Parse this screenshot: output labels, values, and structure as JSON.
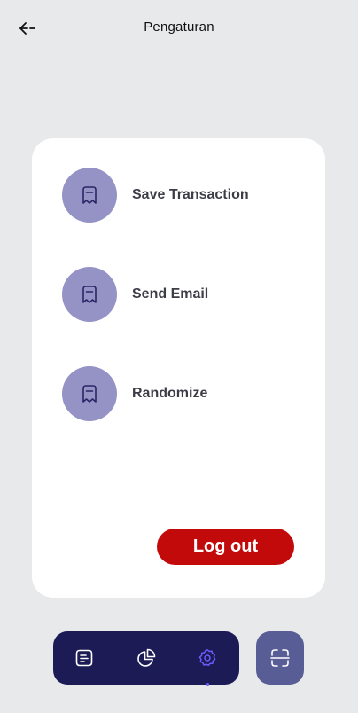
{
  "header": {
    "title": "Pengaturan",
    "back_icon": "arrow-left-icon"
  },
  "settings": {
    "items": [
      {
        "label": "Save Transaction",
        "icon": "receipt-icon"
      },
      {
        "label": "Send Email",
        "icon": "receipt-icon"
      },
      {
        "label": "Randomize",
        "icon": "receipt-icon"
      }
    ],
    "logout_label": "Log out"
  },
  "bottom_nav": {
    "items": [
      {
        "icon": "document-list-icon",
        "active": false
      },
      {
        "icon": "pie-chart-icon",
        "active": false
      },
      {
        "icon": "gear-icon",
        "active": true
      }
    ],
    "scan_icon": "scan-icon"
  },
  "colors": {
    "background": "#e8e9eb",
    "card": "#ffffff",
    "icon_circle": "#9593c5",
    "logout": "#c30a0a",
    "nav_bar": "#1c1b56",
    "scan_button": "#585d96",
    "active_accent": "#6b5cff"
  }
}
